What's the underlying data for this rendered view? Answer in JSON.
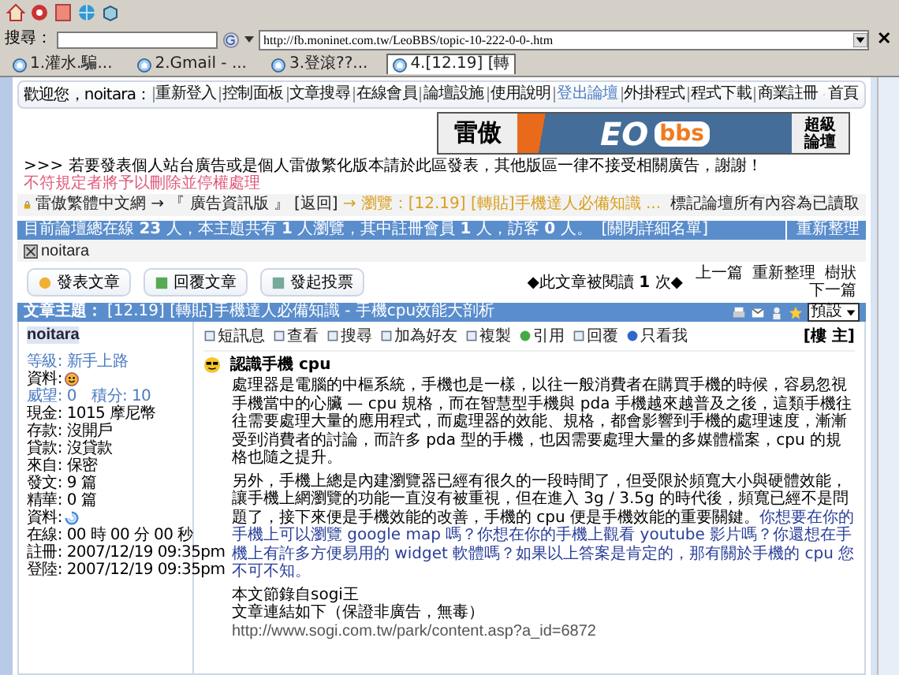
{
  "browser": {
    "search_label": "搜尋：",
    "address": "http://fb.moninet.com.tw/LeoBBS/topic-10-222-0-0-.htm",
    "close": "✕",
    "tabs": [
      {
        "label": "1.灌水.騙...",
        "selected": false
      },
      {
        "label": "2.Gmail - ...",
        "selected": false
      },
      {
        "label": "3.登滾??...",
        "selected": false
      },
      {
        "label": "4.[12.19] [轉",
        "selected": true
      }
    ]
  },
  "nav": {
    "welcome": "歡迎您，noitara：",
    "links": [
      "重新登入",
      "控制面板",
      "文章搜尋",
      "在線會員",
      "論壇設施",
      "使用說明",
      "登出論壇",
      "外掛程式",
      "程式下載",
      "商業註冊"
    ],
    "home": "首頁"
  },
  "banner": {
    "left": "雷傲",
    "logo": "EO",
    "logo_suffix": "bbs",
    "right": [
      "超級",
      "論壇"
    ]
  },
  "notice": {
    "text": ">>> 若要發表個人站台廣告或是個人雷傲繁化版本請於此區發表，其他版區一律不接受相關廣告，謝謝！",
    "highlight": "不符規定者將予以刪除並停權處理"
  },
  "breadcrumb": {
    "site": "雷傲繁體中文網",
    "board": "→ 『 廣告資訊版 』",
    "back": "[返回]",
    "current": "→ 瀏覽：[12.19] [轉貼]手機達人必備知識 ...",
    "mark_read": "標記論壇所有內容為已讀取"
  },
  "online": {
    "summary": "目前論壇總在線 **23** 人，本主題共有 **1** 人瀏覽，其中註冊會員 **1** 人，訪客 **0** 人。",
    "toggle": "[關閉詳細名單]",
    "refresh": "重新整理",
    "users": [
      "noitara"
    ]
  },
  "actions": [
    "發表文章",
    "回覆文章",
    "發起投票"
  ],
  "read_count": "◆此文章被閱讀 **1** 次◆",
  "pager": {
    "prev": "上一篇",
    "refresh": "重新整理",
    "tree": "樹狀",
    "next": "下一篇"
  },
  "topic": {
    "label": "文章主題：",
    "title": "[12.19] [轉貼]手機達人必備知識 - 手機cpu效能大剖析",
    "view_select": "預設"
  },
  "author": {
    "name": "noitara",
    "rows": [
      {
        "text": "等級: 新手上路",
        "kind": "link"
      },
      {
        "text": "資料:",
        "kind": "smiley"
      },
      {
        "text": "威望: 0　積分: 10",
        "kind": "link"
      },
      {
        "text": "現金: 1015 摩尼幣",
        "kind": "text"
      },
      {
        "text": "存款: 沒開戶",
        "kind": "text"
      },
      {
        "text": "貸款: 沒貸款",
        "kind": "text"
      },
      {
        "text": "來自: 保密",
        "kind": "text"
      },
      {
        "text": "發文: 9 篇",
        "kind": "text"
      },
      {
        "text": "精華: 0 篇",
        "kind": "text"
      },
      {
        "text": "資料:",
        "kind": "avatar"
      },
      {
        "text": "在線: 00 時 00 分 00 秒",
        "kind": "text"
      },
      {
        "text": "註冊: 2007/12/19 09:35pm",
        "kind": "text"
      },
      {
        "text": "登陸: 2007/12/19 09:35pm",
        "kind": "text"
      }
    ]
  },
  "post": {
    "tools": [
      "短訊息",
      "查看",
      "搜尋",
      "加為好友",
      "複製",
      "引用",
      "回覆",
      "只看我"
    ],
    "floor": "[樓 主]",
    "title": "認識手機 cpu",
    "paragraphs": [
      {
        "text": "處理器是電腦的中樞系統，手機也是一樣，以往一般消費者在購買手機的時候，容易忽視手機當中的心臟 — cpu 規格，而在智慧型手機與 pda 手機越來越普及之後，這類手機往往需要處理大量的應用程式，而處理器的效能、規格，都會影響到手機的處理速度，漸漸受到消費者的討論，而許多 pda 型的手機，也因需要處理大量的多媒體檔案，cpu 的規格也隨之提升。"
      },
      {
        "text": "另外，手機上總是內建瀏覽器已經有很久的一段時間了，但受限於頻寬大小與硬體效能，讓手機上網瀏覽的功能一直沒有被重視，但在進入 3g / 3.5g 的時代後，頻寬已經不是問題了，接下來便是手機效能的改善，手機的 cpu 便是手機效能的重要關鍵。",
        "highlight": "你想要在你的手機上可以瀏覽 google map 嗎？你想在你的手機上觀看 youtube 影片嗎？你還想在手機上有許多方便易用的 widget 軟體嗎？如果以上答案是肯定的，那有關於手機的 cpu 您不可不知。"
      }
    ],
    "source": [
      "本文節錄自sogi王",
      "文章連結如下（保證非廣告，無毒）"
    ],
    "link": "http://www.sogi.com.tw/park/content.asp?a_id=6872"
  }
}
